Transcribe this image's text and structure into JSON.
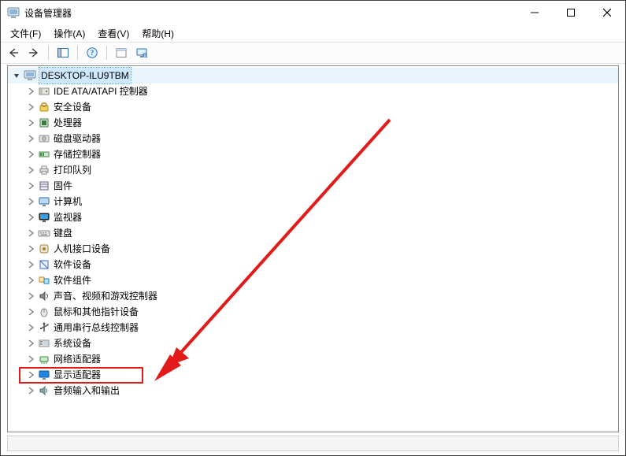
{
  "window": {
    "title": "设备管理器"
  },
  "menus": {
    "file": "文件(F)",
    "action": "操作(A)",
    "view": "查看(V)",
    "help": "帮助(H)"
  },
  "tree": {
    "root": {
      "label": "DESKTOP-ILU9TBM"
    },
    "items": [
      {
        "label": "IDE ATA/ATAPI 控制器",
        "icon": "ide"
      },
      {
        "label": "安全设备",
        "icon": "security"
      },
      {
        "label": "处理器",
        "icon": "cpu"
      },
      {
        "label": "磁盘驱动器",
        "icon": "disk"
      },
      {
        "label": "存储控制器",
        "icon": "storage"
      },
      {
        "label": "打印队列",
        "icon": "printer"
      },
      {
        "label": "固件",
        "icon": "firmware"
      },
      {
        "label": "计算机",
        "icon": "computer"
      },
      {
        "label": "监视器",
        "icon": "monitor"
      },
      {
        "label": "键盘",
        "icon": "keyboard"
      },
      {
        "label": "人机接口设备",
        "icon": "hid"
      },
      {
        "label": "软件设备",
        "icon": "softdev"
      },
      {
        "label": "软件组件",
        "icon": "softcomp"
      },
      {
        "label": "声音、视频和游戏控制器",
        "icon": "sound"
      },
      {
        "label": "鼠标和其他指针设备",
        "icon": "mouse"
      },
      {
        "label": "通用串行总线控制器",
        "icon": "usb"
      },
      {
        "label": "系统设备",
        "icon": "system"
      },
      {
        "label": "网络适配器",
        "icon": "network"
      },
      {
        "label": "显示适配器",
        "icon": "display"
      },
      {
        "label": "音频输入和输出",
        "icon": "audio"
      }
    ]
  },
  "annotation": {
    "highlight_index": 18
  }
}
